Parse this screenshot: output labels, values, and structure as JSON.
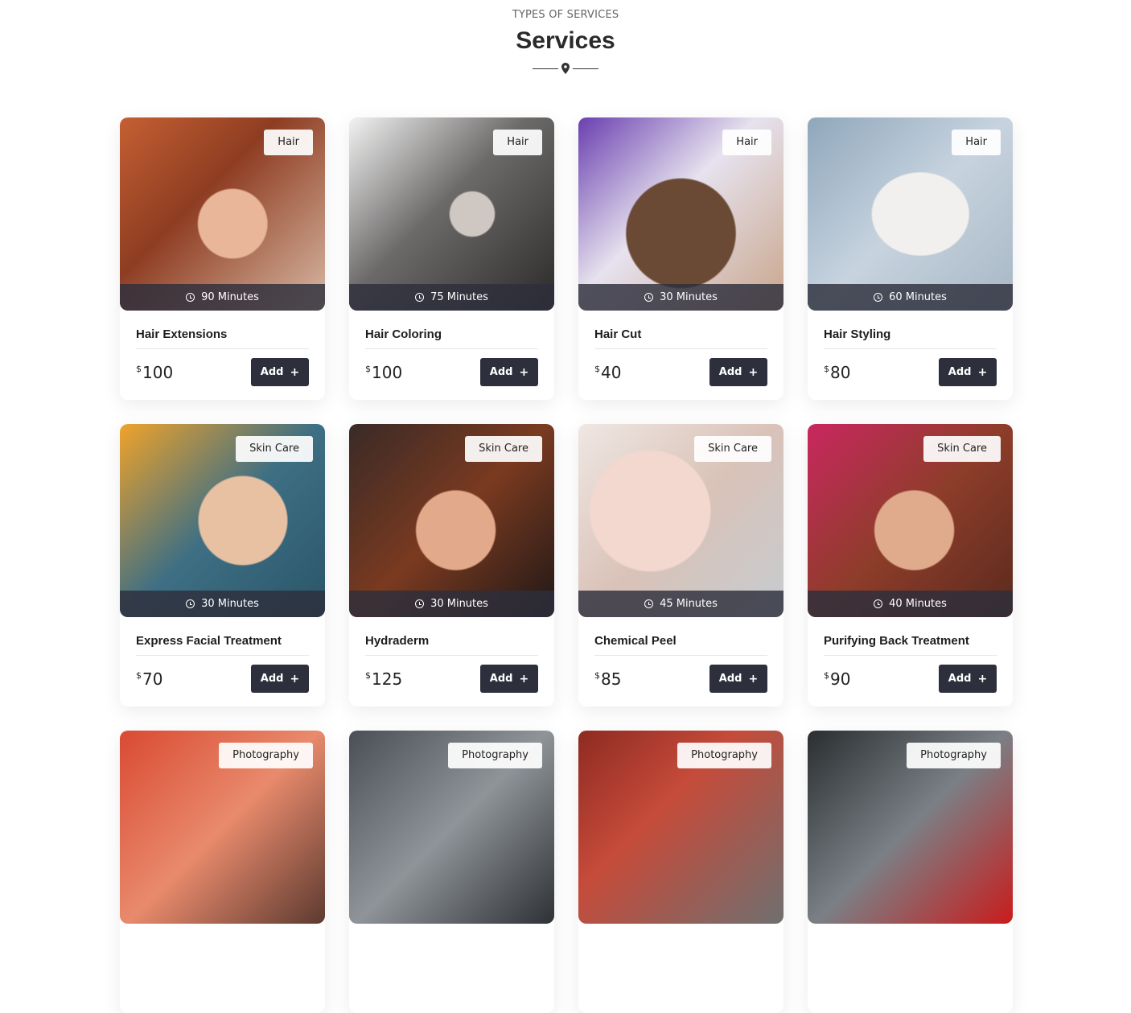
{
  "header": {
    "eyebrow": "TYPES OF SERVICES",
    "title": "Services",
    "divider_icon": "map-pin-icon"
  },
  "cards": [
    {
      "tag": "Hair",
      "duration": "90 Minutes",
      "name": "Hair Extensions",
      "currency": "$",
      "price": "100",
      "button": "Add"
    },
    {
      "tag": "Hair",
      "duration": "75 Minutes",
      "name": "Hair Coloring",
      "currency": "$",
      "price": "100",
      "button": "Add"
    },
    {
      "tag": "Hair",
      "duration": "30 Minutes",
      "name": "Hair Cut",
      "currency": "$",
      "price": "40",
      "button": "Add"
    },
    {
      "tag": "Hair",
      "duration": "60 Minutes",
      "name": "Hair Styling",
      "currency": "$",
      "price": "80",
      "button": "Add"
    },
    {
      "tag": "Skin Care",
      "duration": "30 Minutes",
      "name": "Express Facial Treatment",
      "currency": "$",
      "price": "70",
      "button": "Add"
    },
    {
      "tag": "Skin Care",
      "duration": "30 Minutes",
      "name": "Hydraderm",
      "currency": "$",
      "price": "125",
      "button": "Add"
    },
    {
      "tag": "Skin Care",
      "duration": "45 Minutes",
      "name": "Chemical Peel",
      "currency": "$",
      "price": "85",
      "button": "Add"
    },
    {
      "tag": "Skin Care",
      "duration": "40 Minutes",
      "name": "Purifying Back Treatment",
      "currency": "$",
      "price": "90",
      "button": "Add"
    },
    {
      "tag": "Photography"
    },
    {
      "tag": "Photography"
    },
    {
      "tag": "Photography"
    },
    {
      "tag": "Photography"
    }
  ],
  "colors": {
    "button_bg": "#2d2f3c",
    "duration_bar": "#2d2e3c",
    "title": "#2a2a2a"
  }
}
